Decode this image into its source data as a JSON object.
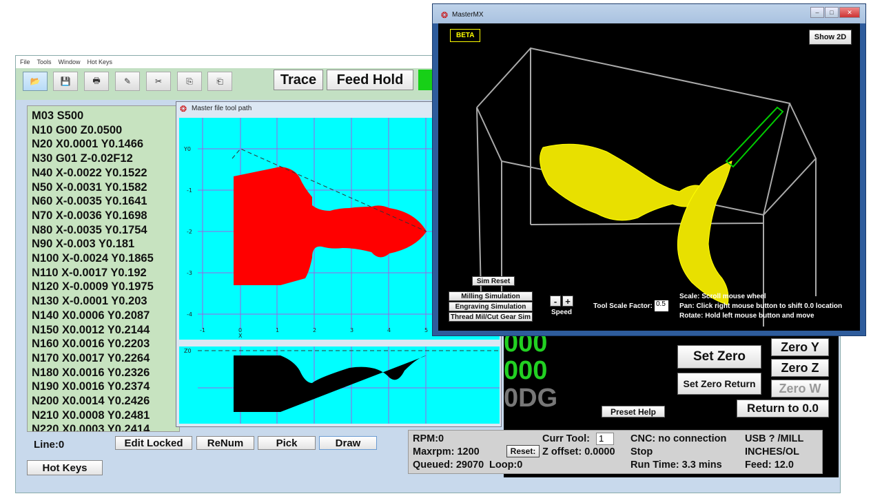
{
  "menu": [
    "File",
    "Tools",
    "Window",
    "Hot Keys"
  ],
  "toolbar": {
    "icons": [
      "open-icon",
      "save-icon",
      "print-icon",
      "eraser-icon",
      "cut-icon",
      "copy-icon",
      "paste-icon"
    ],
    "glyphs": [
      "📂",
      "💾",
      "🖶",
      "✎",
      "✂",
      "⎘",
      "⎗"
    ],
    "trace": "Trace",
    "feed_hold": "Feed Hold"
  },
  "code_lines": [
    "M03 S500",
    "N10 G00 Z0.0500",
    "N20 X0.0001 Y0.1466",
    "N30 G01 Z-0.02F12",
    "N40 X-0.0022 Y0.1522",
    "N50 X-0.0031 Y0.1582",
    "N60 X-0.0035 Y0.1641",
    "N70 X-0.0036 Y0.1698",
    "N80 X-0.0035 Y0.1754",
    "N90 X-0.003 Y0.181",
    "N100 X-0.0024 Y0.1865",
    "N110 X-0.0017 Y0.192",
    "N120 X-0.0009 Y0.1975",
    "N130 X-0.0001 Y0.203",
    "N140 X0.0006 Y0.2087",
    "N150 X0.0012 Y0.2144",
    "N160 X0.0016 Y0.2203",
    "N170 X0.0017 Y0.2264",
    "N180 X0.0016 Y0.2326",
    "N190 X0.0016 Y0.2374",
    "N200 X0.0014 Y0.2426",
    "N210 X0.0008 Y0.2481",
    "N220 X0.0003 Y0.2414"
  ],
  "bottom": {
    "line": "Line:0",
    "edit_locked": "Edit Locked",
    "renum": "ReNum",
    "pick": "Pick",
    "draw": "Draw",
    "hot_keys": "Hot Keys"
  },
  "dro": {
    "y_tail": "000",
    "z_tail": "000",
    "w_tail": "0DG"
  },
  "right_buttons": {
    "set_zero": "Set Zero",
    "set_zero_return": "Set Zero Return",
    "zero_y": "Zero Y",
    "zero_z": "Zero Z",
    "zero_w": "Zero W",
    "return": "Return to 0.0",
    "preset_help": "Preset Help"
  },
  "status": {
    "rpm": "RPM:0",
    "maxrpm": "Maxrpm: 1200",
    "queued": "Queued: 29070",
    "loop": "Loop:0",
    "reset": "Reset:",
    "curr_tool_label": "Curr Tool:",
    "curr_tool_value": "1",
    "z_offset": "Z offset: 0.0000",
    "cnc": "CNC: no connection",
    "stop": "Stop",
    "runtime": "Run Time: 3.3 mins",
    "usb": "USB ? /MILL",
    "units": "INCHES/OL",
    "feed": "Feed: 12.0"
  },
  "toolpath_window": {
    "title": "Master file tool path",
    "x_ticks": [
      "-1",
      "0",
      "1",
      "2",
      "3",
      "4",
      "5"
    ],
    "y_ticks": [
      "Y0",
      "-1",
      "-2",
      "-3",
      "-4"
    ],
    "x_label": "X",
    "z_label": "Z0"
  },
  "mx_window": {
    "title": "MasterMX",
    "beta": "BETA",
    "show2d": "Show 2D",
    "sim_reset": "Sim Reset",
    "milling": "Milling Simulation",
    "engraving": "Engraving Simulation",
    "thread": "Thread Mil/Cut Gear Sim",
    "minus": "-",
    "plus": "+",
    "speed": "Speed",
    "tool_scale_label": "Tool Scale Factor:",
    "tool_scale_value": "0.5",
    "scale_help": "Scale: Scroll mouse wheel",
    "pan_help": "Pan: Click right mouse button to shift  0.0  location",
    "rotate_help": "Rotate: Hold left mouse button and move"
  },
  "colors": {
    "app_bg": "#c8d9ec",
    "code_bg": "#c7e3c0",
    "plot_bg": "#00ffff",
    "part": "#ff0000",
    "dro": "#22d022",
    "mesh": "#ffff00",
    "tool": "#00cc00"
  }
}
